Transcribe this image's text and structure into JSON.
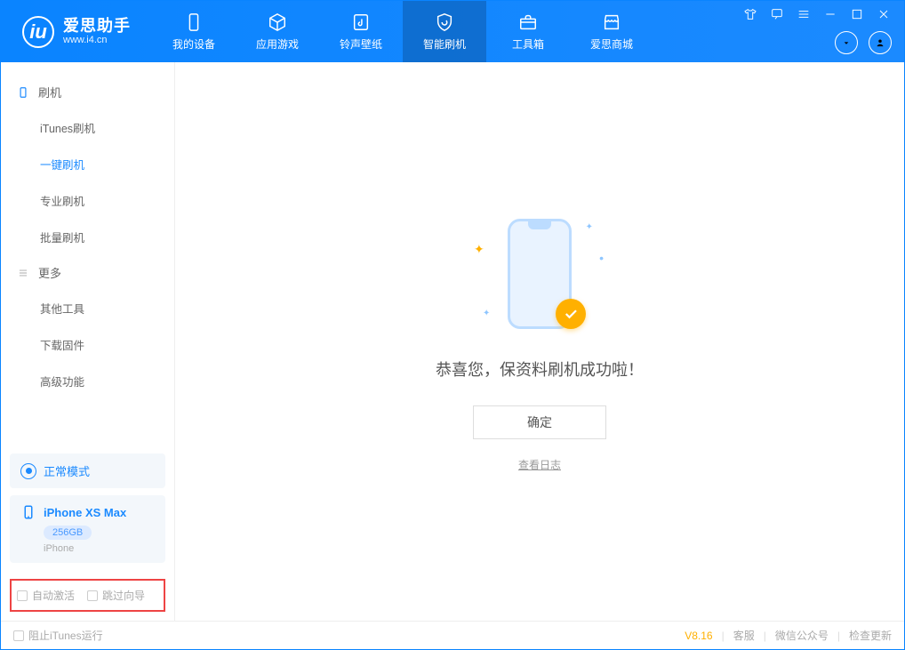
{
  "app": {
    "name": "爱思助手",
    "url": "www.i4.cn"
  },
  "tabs": {
    "device": "我的设备",
    "apps": "应用游戏",
    "ring": "铃声壁纸",
    "flash": "智能刷机",
    "tools": "工具箱",
    "store": "爱思商城"
  },
  "sidebar": {
    "flash_section": "刷机",
    "items": {
      "itunes": "iTunes刷机",
      "oneclick": "一键刷机",
      "pro": "专业刷机",
      "batch": "批量刷机"
    },
    "more_section": "更多",
    "more": {
      "other": "其他工具",
      "firmware": "下载固件",
      "advanced": "高级功能"
    }
  },
  "device_cards": {
    "mode": "正常模式",
    "phone_name": "iPhone XS Max",
    "capacity": "256GB",
    "phone_type": "iPhone"
  },
  "checks": {
    "auto_activate": "自动激活",
    "skip_guide": "跳过向导"
  },
  "result": {
    "message": "恭喜您，保资料刷机成功啦！",
    "ok": "确定",
    "log": "查看日志"
  },
  "footer": {
    "block_itunes": "阻止iTunes运行",
    "version": "V8.16",
    "support": "客服",
    "wechat": "微信公众号",
    "update": "检查更新"
  }
}
